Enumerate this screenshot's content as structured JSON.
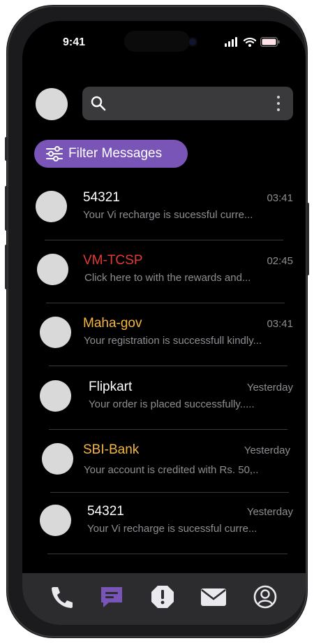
{
  "status_bar": {
    "time": "9:41"
  },
  "search": {
    "placeholder": ""
  },
  "filter_button": {
    "label": "Filter Messages"
  },
  "messages": [
    {
      "sender": "54321",
      "time": "03:41",
      "preview": "Your Vi recharge is sucessful curre...",
      "sender_color": "#ffffff"
    },
    {
      "sender": "VM-TCSP",
      "time": "02:45",
      "preview": "Click here to with the rewards and...",
      "sender_color": "#e53935"
    },
    {
      "sender": "Maha-gov",
      "time": "03:41",
      "preview": "Your registration is successfull kindly...",
      "sender_color": "#f4b63f"
    },
    {
      "sender": "Flipkart",
      "time": "Yesterday",
      "preview": "Your order is placed successfully.....",
      "sender_color": "#ffffff"
    },
    {
      "sender": "SBI-Bank",
      "time": "Yesterday",
      "preview": "Your account is credited with Rs. 50,..",
      "sender_color": "#f4b63f"
    },
    {
      "sender": "54321",
      "time": "Yesterday",
      "preview": "Your Vi recharge is sucessful curre...",
      "sender_color": "#ffffff"
    }
  ],
  "bottom_nav": {
    "items": [
      {
        "icon": "phone-icon",
        "active": false
      },
      {
        "icon": "messages-icon",
        "active": true
      },
      {
        "icon": "alert-icon",
        "active": false
      },
      {
        "icon": "mail-icon",
        "active": false
      },
      {
        "icon": "profile-icon",
        "active": false
      }
    ]
  },
  "colors": {
    "accent": "#7a55b8",
    "background": "#000000",
    "nav_background": "#2c2c2e",
    "avatar": "#d9d9d9",
    "secondary_text": "#8e8e93"
  }
}
